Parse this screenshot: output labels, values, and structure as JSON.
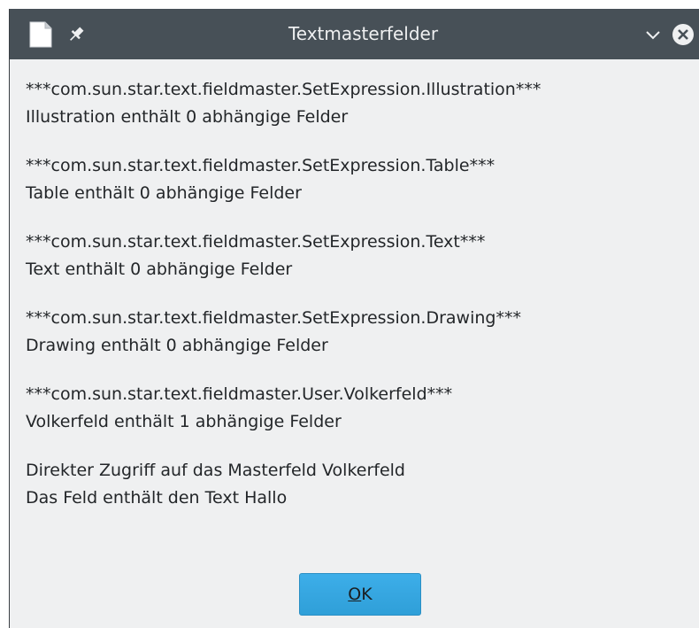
{
  "window": {
    "title": "Textmasterfelder"
  },
  "icons": {
    "app": "document-icon",
    "pin": "pin-icon",
    "minimize": "chevron-down-icon",
    "close": "close-icon"
  },
  "colors": {
    "titlebar": "#475057",
    "background": "#eff0f1",
    "button": "#3daee9"
  },
  "message": {
    "blocks": [
      {
        "line1": "***com.sun.star.text.fieldmaster.SetExpression.Illustration***",
        "line2": "Illustration enthält 0 abhängige Felder"
      },
      {
        "line1": "***com.sun.star.text.fieldmaster.SetExpression.Table***",
        "line2": "Table enthält 0 abhängige Felder"
      },
      {
        "line1": "***com.sun.star.text.fieldmaster.SetExpression.Text***",
        "line2": "Text enthält 0 abhängige Felder"
      },
      {
        "line1": "***com.sun.star.text.fieldmaster.SetExpression.Drawing***",
        "line2": "Drawing enthält 0 abhängige Felder"
      },
      {
        "line1": "***com.sun.star.text.fieldmaster.User.Volkerfeld***",
        "line2": "Volkerfeld enthält 1 abhängige Felder"
      },
      {
        "line1": "Direkter Zugriff auf das Masterfeld Volkerfeld",
        "line2": "Das Feld enthält den Text Hallo"
      }
    ]
  },
  "buttons": {
    "ok_mnemonic": "O",
    "ok_rest": "K"
  }
}
